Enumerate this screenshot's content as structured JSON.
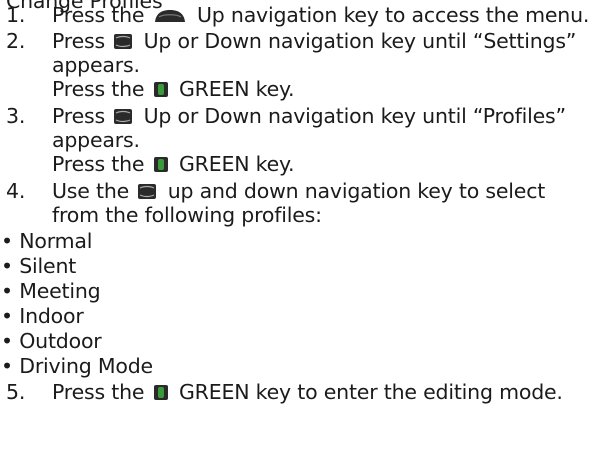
{
  "partial_top_line": "Change Profiles",
  "steps": [
    {
      "number": "1.",
      "lines": [
        {
          "before": "Press the",
          "after": "Up navigation key to access the menu."
        }
      ],
      "icon": "up-key-icon"
    },
    {
      "number": "2.",
      "lines": [
        {
          "before": "Press",
          "after": "Up or Down navigation key until “Settings”"
        },
        {
          "text": "appears."
        },
        {
          "before": "Press the",
          "after": "GREEN key."
        }
      ]
    },
    {
      "number": "3.",
      "lines": [
        {
          "before": "Press",
          "after": "Up or Down navigation key until “Profiles”"
        },
        {
          "text": "appears."
        },
        {
          "before": "Press the",
          "after": "GREEN key."
        }
      ]
    },
    {
      "number": "4.",
      "lines": [
        {
          "before": "Use the",
          "after": "up and down navigation key to select"
        },
        {
          "text": "from the following profiles:"
        }
      ]
    },
    {
      "number": "5.",
      "lines": [
        {
          "before": "Press the",
          "after": "GREEN key to enter the editing mode."
        }
      ]
    }
  ],
  "profiles": [
    "Normal",
    "Silent",
    "Meeting",
    "Indoor",
    "Outdoor",
    "Driving Mode"
  ],
  "bullet": "•",
  "colors": {
    "text": "#1b1b1b",
    "green_key": "#3a9a3a",
    "key_dark": "#2a2a2a"
  }
}
